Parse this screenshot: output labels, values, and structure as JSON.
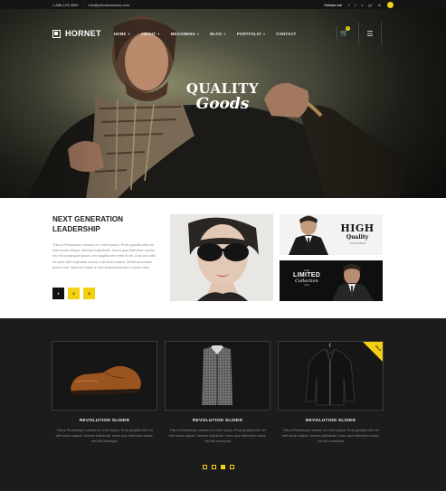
{
  "topbar": {
    "phone": "1-888-123-4659",
    "separator": "/",
    "email": "info@yelinabusiness.com",
    "follow_label": "Follow me",
    "social": [
      {
        "icon": "facebook-icon",
        "glyph": "f"
      },
      {
        "icon": "twitter-icon",
        "glyph": "t"
      },
      {
        "icon": "vimeo-icon",
        "glyph": "v"
      },
      {
        "icon": "google-plus-icon",
        "glyph": "g+"
      },
      {
        "icon": "linkedin-icon",
        "glyph": "in"
      }
    ]
  },
  "brand": {
    "name": "HORNET"
  },
  "nav": {
    "items": [
      {
        "label": "HOME",
        "has_dropdown": true
      },
      {
        "label": "ABOUT",
        "has_dropdown": true
      },
      {
        "label": "MEGAMENU",
        "has_dropdown": true
      },
      {
        "label": "BLOG",
        "has_dropdown": true
      },
      {
        "label": "PORTFOLIO",
        "has_dropdown": true
      },
      {
        "label": "CONTACT",
        "has_dropdown": false
      }
    ],
    "cart_count": "0",
    "cart_icon": "cart-icon",
    "menu_icon": "hamburger-icon"
  },
  "hero": {
    "headline_line1": "QUALITY",
    "headline_line2": "Goods"
  },
  "intro": {
    "title": "NEXT GENERATION LEADERSHIP",
    "body": "This is Photoshop's version of Lorem Ipsum. Proin gravida nibh vel velit auctor aliquet. Aenean sollicitudin, lorem quis bibendum auctor, nisi elit consequat ipsum, nec sagittis sem nibh id elit. Duis sed odio sit amet nibh vulputate cursus a sit amet mauris. Morbi accumsan ipsum velit. Nam nec tellus a odio tincidunt auctor a ornare odio.",
    "pages": [
      "1",
      "2",
      "3"
    ]
  },
  "promos": {
    "high": {
      "line1": "HIGH",
      "line2": "Quality",
      "line3": "STYLE 2015"
    },
    "limited": {
      "line1": "THE",
      "line2": "LIMITED",
      "line3": "Collection",
      "line4": "2015"
    }
  },
  "products": [
    {
      "title": "REVOLUTION SLIDER",
      "image": "leather-shoe",
      "sale": false,
      "desc": "This is Photoshop's version of Lorem Ipsum. Proin gravida nibh vel velit auctor aliquet. Aenean sollicitudin, lorem quis bibendum auctor, nisi elit consequat"
    },
    {
      "title": "REVOLUTION SLIDER",
      "image": "checked-shirt",
      "sale": false,
      "desc": "This is Photoshop's version of Lorem Ipsum. Proin gravida nibh vel velit auctor aliquet. Aenean sollicitudin, lorem quis bibendum auctor, nisi elit consequat"
    },
    {
      "title": "REVOLUTION SLIDER",
      "image": "leather-jacket",
      "sale": true,
      "sale_label": "SALE",
      "desc": "This is Photoshop's version of Lorem Ipsum. Proin gravida nibh vel velit auctor aliquet. Aenean sollicitudin, lorem quis bibendum auctor, nisi elit consequat"
    }
  ],
  "carousel": {
    "active_index": 2,
    "count": 4
  },
  "colors": {
    "accent": "#f5d012",
    "dark_bg": "#1c1c1c",
    "topbar_bg": "#151515"
  }
}
